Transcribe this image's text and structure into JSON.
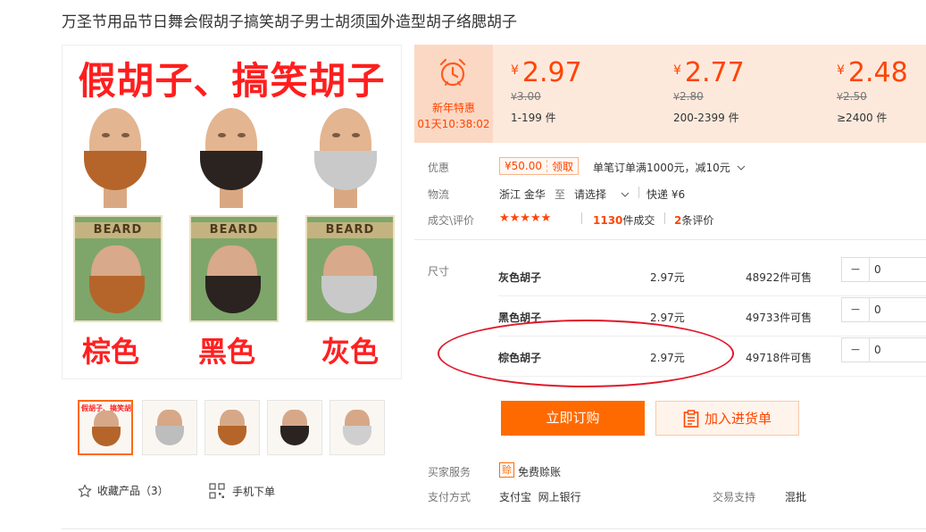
{
  "title": "万圣节用品节日舞会假胡子搞笑胡子男士胡须国外造型胡子络腮胡子",
  "main_image": {
    "headline": "假胡子、搞笑胡子",
    "pack_label": "BEARD",
    "colors": [
      "棕色",
      "黑色",
      "灰色"
    ]
  },
  "thumbnails": [
    {
      "caption": "假胡子、搞笑胡子",
      "beard_color": "#b5652a",
      "active": true
    },
    {
      "caption": "",
      "beard_color": "#bdbdbd",
      "active": false
    },
    {
      "caption": "",
      "beard_color": "#b5652a",
      "active": false
    },
    {
      "caption": "",
      "beard_color": "#2a2320",
      "active": false
    },
    {
      "caption": "",
      "beard_color": "#cfcfcf",
      "active": false
    }
  ],
  "actions": {
    "favorite": "收藏产品（3）",
    "mobile_order": "手机下单"
  },
  "promo": {
    "name": "新年特惠",
    "countdown": "01天10:38:02"
  },
  "price_tiers": [
    {
      "currency": "¥",
      "price": "2.97",
      "old_price": "3.00",
      "range": "1-199 件"
    },
    {
      "currency": "¥",
      "price": "2.77",
      "old_price": "2.80",
      "range": "200-2399 件"
    },
    {
      "currency": "¥",
      "price": "2.48",
      "old_price": "2.50",
      "range": "≥2400 件"
    }
  ],
  "discount": {
    "label": "优惠",
    "coupon_amount": "¥50.00",
    "coupon_action": "领取",
    "rule": "单笔订单满1000元，减10元"
  },
  "logistics": {
    "label": "物流",
    "from": "浙江 金华",
    "to_word": "至",
    "to": "请选择",
    "express": "快递 ¥6"
  },
  "deals": {
    "label": "成交\\评价",
    "stars": "★★★★★",
    "sold_count": "1130",
    "sold_unit": "件成交",
    "review_count": "2",
    "review_unit": "条评价"
  },
  "sku": {
    "label": "尺寸",
    "rows": [
      {
        "name": "灰色胡子",
        "price": "2.97元",
        "stock": "48922件可售",
        "qty": "0"
      },
      {
        "name": "黑色胡子",
        "price": "2.97元",
        "stock": "49733件可售",
        "qty": "0"
      },
      {
        "name": "棕色胡子",
        "price": "2.97元",
        "stock": "49718件可售",
        "qty": "0"
      }
    ]
  },
  "buttons": {
    "order": "立即订购",
    "cart": "加入进货单"
  },
  "service": {
    "label": "买家服务",
    "badge": "赊",
    "value": "免费赊账"
  },
  "payment": {
    "label": "支付方式",
    "value": "支付宝  网上银行",
    "support_label": "交易支持",
    "support_value": "混批"
  },
  "colors": {
    "accent": "#ff6a00",
    "price": "#ff4400",
    "price_bg": "#fde9dc",
    "annotation": "#e0182a"
  }
}
